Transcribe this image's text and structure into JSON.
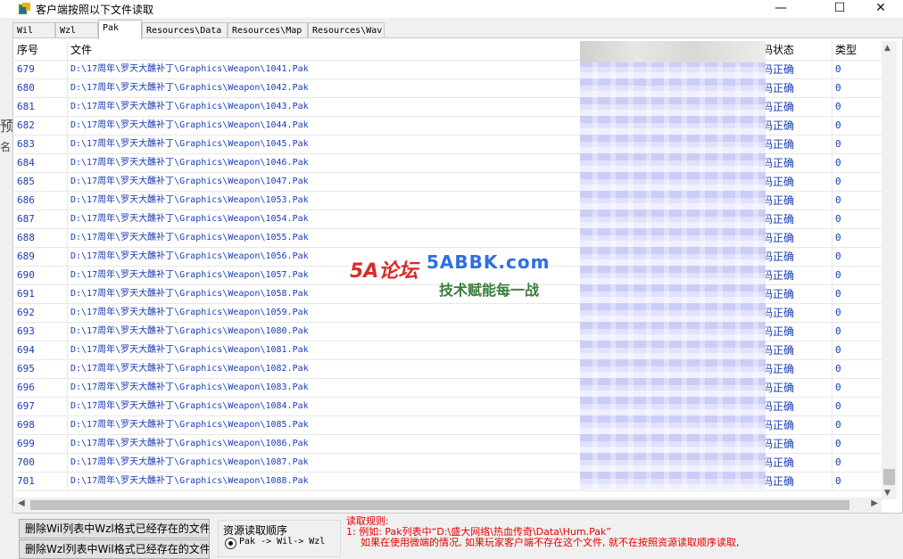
{
  "window": {
    "title": "客户端按照以下文件读取",
    "minimize": "—",
    "maximize": "☐",
    "close": "✕"
  },
  "tabs": [
    {
      "label": "Wil",
      "active": false
    },
    {
      "label": "Wzl",
      "active": false
    },
    {
      "label": "Pak",
      "active": true
    },
    {
      "label": "Resources\\Data",
      "active": false
    },
    {
      "label": "Resources\\Map",
      "active": false
    },
    {
      "label": "Resources\\Wav",
      "active": false
    }
  ],
  "table": {
    "columns": {
      "index": "序号",
      "file": "文件",
      "status": "码状态",
      "type": "类型"
    },
    "rows": [
      {
        "index": "679",
        "file": "D:\\17周年\\罗天大醮补丁\\Graphics\\Weapon\\1041.Pak",
        "status": "码正确",
        "type": "0"
      },
      {
        "index": "680",
        "file": "D:\\17周年\\罗天大醮补丁\\Graphics\\Weapon\\1042.Pak",
        "status": "码正确",
        "type": "0"
      },
      {
        "index": "681",
        "file": "D:\\17周年\\罗天大醮补丁\\Graphics\\Weapon\\1043.Pak",
        "status": "码正确",
        "type": "0"
      },
      {
        "index": "682",
        "file": "D:\\17周年\\罗天大醮补丁\\Graphics\\Weapon\\1044.Pak",
        "status": "码正确",
        "type": "0"
      },
      {
        "index": "683",
        "file": "D:\\17周年\\罗天大醮补丁\\Graphics\\Weapon\\1045.Pak",
        "status": "码正确",
        "type": "0"
      },
      {
        "index": "684",
        "file": "D:\\17周年\\罗天大醮补丁\\Graphics\\Weapon\\1046.Pak",
        "status": "码正确",
        "type": "0"
      },
      {
        "index": "685",
        "file": "D:\\17周年\\罗天大醮补丁\\Graphics\\Weapon\\1047.Pak",
        "status": "码正确",
        "type": "0"
      },
      {
        "index": "686",
        "file": "D:\\17周年\\罗天大醮补丁\\Graphics\\Weapon\\1053.Pak",
        "status": "码正确",
        "type": "0"
      },
      {
        "index": "687",
        "file": "D:\\17周年\\罗天大醮补丁\\Graphics\\Weapon\\1054.Pak",
        "status": "码正确",
        "type": "0"
      },
      {
        "index": "688",
        "file": "D:\\17周年\\罗天大醮补丁\\Graphics\\Weapon\\1055.Pak",
        "status": "码正确",
        "type": "0"
      },
      {
        "index": "689",
        "file": "D:\\17周年\\罗天大醮补丁\\Graphics\\Weapon\\1056.Pak",
        "status": "码正确",
        "type": "0"
      },
      {
        "index": "690",
        "file": "D:\\17周年\\罗天大醮补丁\\Graphics\\Weapon\\1057.Pak",
        "status": "码正确",
        "type": "0"
      },
      {
        "index": "691",
        "file": "D:\\17周年\\罗天大醮补丁\\Graphics\\Weapon\\1058.Pak",
        "status": "码正确",
        "type": "0"
      },
      {
        "index": "692",
        "file": "D:\\17周年\\罗天大醮补丁\\Graphics\\Weapon\\1059.Pak",
        "status": "码正确",
        "type": "0"
      },
      {
        "index": "693",
        "file": "D:\\17周年\\罗天大醮补丁\\Graphics\\Weapon\\1080.Pak",
        "status": "码正确",
        "type": "0"
      },
      {
        "index": "694",
        "file": "D:\\17周年\\罗天大醮补丁\\Graphics\\Weapon\\1081.Pak",
        "status": "码正确",
        "type": "0"
      },
      {
        "index": "695",
        "file": "D:\\17周年\\罗天大醮补丁\\Graphics\\Weapon\\1082.Pak",
        "status": "码正确",
        "type": "0"
      },
      {
        "index": "696",
        "file": "D:\\17周年\\罗天大醮补丁\\Graphics\\Weapon\\1083.Pak",
        "status": "码正确",
        "type": "0"
      },
      {
        "index": "697",
        "file": "D:\\17周年\\罗天大醮补丁\\Graphics\\Weapon\\1084.Pak",
        "status": "码正确",
        "type": "0"
      },
      {
        "index": "698",
        "file": "D:\\17周年\\罗天大醮补丁\\Graphics\\Weapon\\1085.Pak",
        "status": "码正确",
        "type": "0"
      },
      {
        "index": "699",
        "file": "D:\\17周年\\罗天大醮补丁\\Graphics\\Weapon\\1086.Pak",
        "status": "码正确",
        "type": "0"
      },
      {
        "index": "700",
        "file": "D:\\17周年\\罗天大醮补丁\\Graphics\\Weapon\\1087.Pak",
        "status": "码正确",
        "type": "0"
      },
      {
        "index": "701",
        "file": "D:\\17周年\\罗天大醮补丁\\Graphics\\Weapon\\1088.Pak",
        "status": "码正确",
        "type": "0"
      }
    ]
  },
  "buttons": {
    "delete_wil": "删除Wil列表中Wzl格式已经存在的文件",
    "delete_wzl": "删除Wzl列表中Wil格式已经存在的文件"
  },
  "read_order": {
    "title": "资源读取顺序",
    "option_selected": "Pak -> Wil-> Wzl"
  },
  "rules": {
    "title": "读取规则:",
    "line1": "1: 例如: Pak列表中“D:\\盛大网络\\热血传奇\\Data\\Hum.Pak”",
    "line2": "如果在使用微端的情况, 如果玩家客户端不存在这个文件, 就不在按照资源读取顺序读取,"
  },
  "watermark": {
    "logo": "5A论坛",
    "site": "5ABBK.com",
    "slogan": "技术赋能每一战"
  },
  "side_stub": {
    "char1": "预",
    "char2": "名"
  },
  "scroll_glyphs": {
    "up": "▲",
    "down": "▼",
    "left": "◀",
    "right": "▶"
  }
}
